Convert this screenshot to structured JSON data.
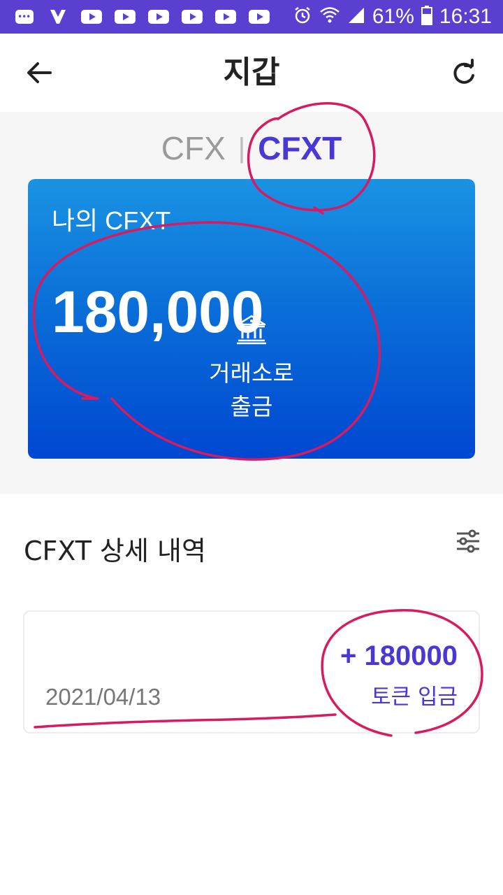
{
  "status_bar": {
    "battery": "61%",
    "time": "16:31"
  },
  "header": {
    "title": "지갑"
  },
  "tabs": [
    {
      "label": "CFX",
      "active": false
    },
    {
      "label": "CFXT",
      "active": true
    }
  ],
  "tab_separator": "|",
  "card": {
    "label": "나의 CFXT",
    "balance": "180,000",
    "withdraw_label": "거래소로\n출금"
  },
  "history": {
    "title": "CFXT 상세 내역",
    "transactions": [
      {
        "amount": "+ 180000",
        "date": "2021/04/13",
        "type": "토큰 입금"
      }
    ]
  },
  "colors": {
    "status_bar": "#5a3fd0",
    "accent": "#4a38d6",
    "card_top": "#1a93e3",
    "card_bottom": "#0047d1",
    "annotation": "#d81b60"
  },
  "icons": {
    "back": "arrow-left-icon",
    "refresh": "refresh-icon",
    "filter": "filter-sliders-icon",
    "bank": "bank-icon"
  }
}
